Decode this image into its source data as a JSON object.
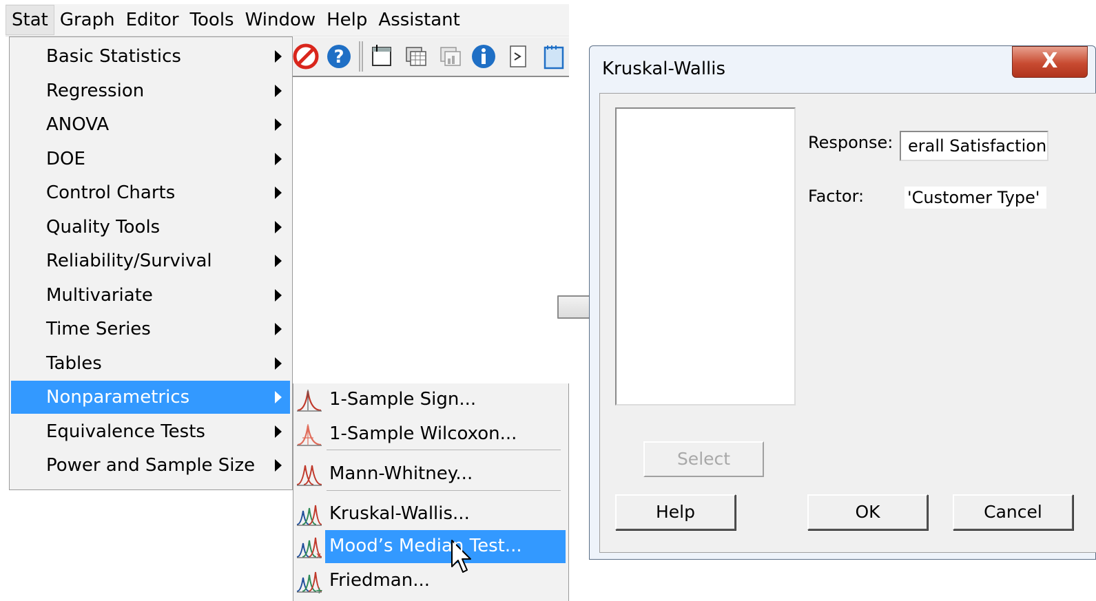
{
  "menubar": {
    "items": [
      "Stat",
      "Graph",
      "Editor",
      "Tools",
      "Window",
      "Help",
      "Assistant"
    ],
    "active": "Stat"
  },
  "toolbar": {
    "icons": [
      "cancel-icon",
      "help-icon",
      "new-icon",
      "table-icon",
      "table-gray-icon",
      "info-icon",
      "command-icon",
      "notepad-icon"
    ]
  },
  "stat_menu": {
    "items": [
      {
        "label": "Basic Statistics"
      },
      {
        "label": "Regression"
      },
      {
        "label": "ANOVA"
      },
      {
        "label": "DOE"
      },
      {
        "label": "Control Charts"
      },
      {
        "label": "Quality Tools"
      },
      {
        "label": "Reliability/Survival"
      },
      {
        "label": "Multivariate"
      },
      {
        "label": "Time Series"
      },
      {
        "label": "Tables"
      },
      {
        "label": "Nonparametrics"
      },
      {
        "label": "Equivalence Tests"
      },
      {
        "label": "Power and Sample Size"
      }
    ],
    "selected": "Nonparametrics"
  },
  "nonparametrics_menu": {
    "items": [
      {
        "label": "1-Sample Sign..."
      },
      {
        "label": "1-Sample Wilcoxon..."
      },
      {
        "label": "Mann-Whitney..."
      },
      {
        "label": "Kruskal-Wallis..."
      },
      {
        "label": "Mood’s Median Test..."
      },
      {
        "label": "Friedman..."
      }
    ],
    "selected": "Mood’s Median Test..."
  },
  "dialog": {
    "title": "Kruskal-Wallis",
    "close_label": "X",
    "response_label": "Response:",
    "response_value": "erall Satisfaction'",
    "factor_label": "Factor:",
    "factor_value": "'Customer Type'",
    "select_label": "Select",
    "help_label": "Help",
    "ok_label": "OK",
    "cancel_label": "Cancel"
  },
  "colors": {
    "highlight": "#3399ff",
    "menu_bg": "#f2f2f2",
    "dialog_bg": "#f0f0f0",
    "close_red": "#c84b31"
  }
}
